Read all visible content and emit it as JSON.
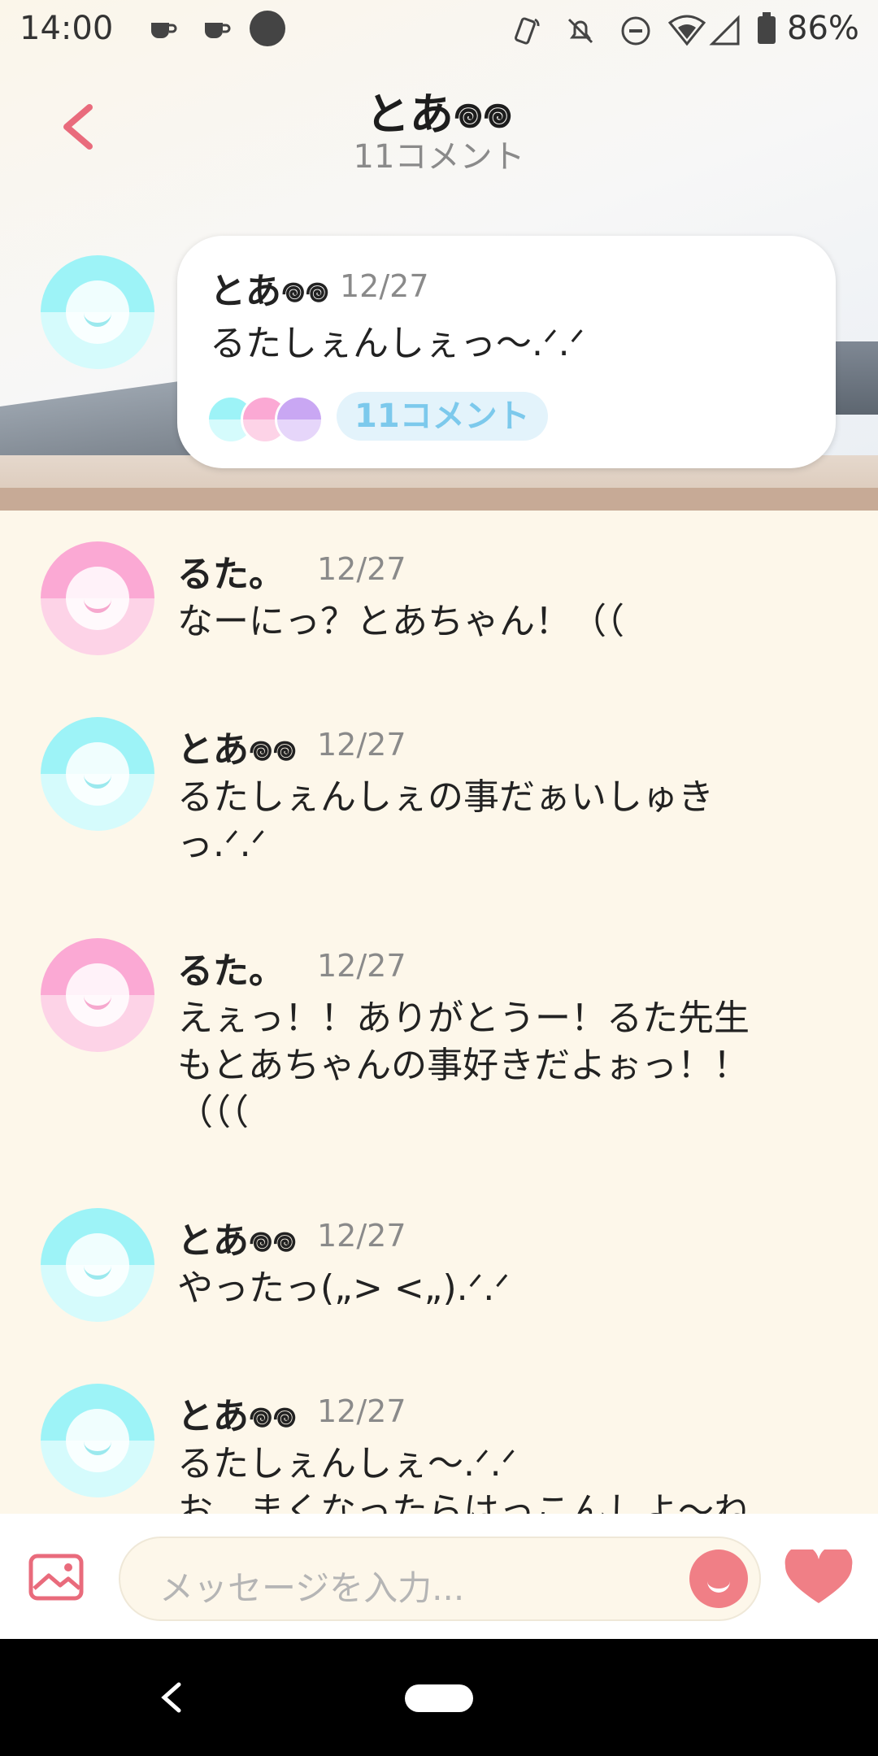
{
  "status_bar": {
    "time": "14:00",
    "battery": "86%"
  },
  "header": {
    "title": "とあ𖦹𖦹",
    "subtitle": "11コメント"
  },
  "post": {
    "author": "とあ𖦹𖦹",
    "date": "12/27",
    "text": "るたしぇんしぇっ〜.ᐟ.ᐟ",
    "comment_label": "11コメント"
  },
  "comments": [
    {
      "author": "るた。",
      "date": "12/27",
      "text": "なーにっ？とあちゃん！（（",
      "avatar": "pink"
    },
    {
      "author": "とあ𖦹𖦹",
      "date": "12/27",
      "text": "るたしぇんしぇの事だぁいしゅき\nっ.ᐟ.ᐟ",
      "avatar": "cyan"
    },
    {
      "author": "るた。",
      "date": "12/27",
      "text": "えぇっ！！ありがとうー！るた先生\nもとあちゃんの事好きだよぉっ！！\n（（（",
      "avatar": "pink"
    },
    {
      "author": "とあ𖦹𖦹",
      "date": "12/27",
      "text": "やったっ(„> <„).ᐟ.ᐟ",
      "avatar": "cyan"
    },
    {
      "author": "とあ𖦹𖦹",
      "date": "12/27",
      "text": "るたしぇんしぇ〜.ᐟ.ᐟ\nお、まくなったらはっこんしよ〜ね",
      "avatar": "cyan"
    }
  ],
  "input": {
    "placeholder": "メッセージを入力..."
  },
  "colors": {
    "accent": "#f07f86",
    "background": "#fdf7ea"
  }
}
